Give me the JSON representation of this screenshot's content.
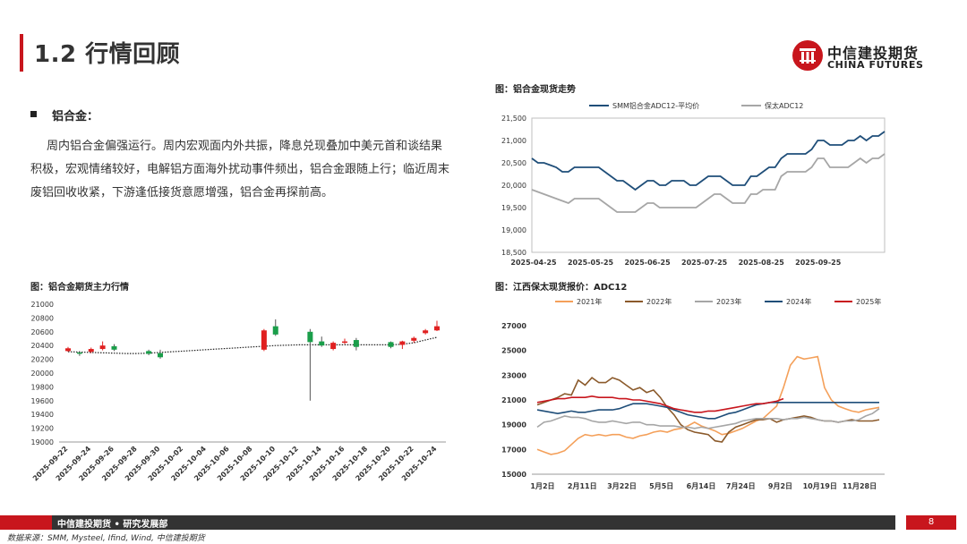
{
  "page": {
    "title": "1.2 行情回顾",
    "logo_cn": "中信建投期货",
    "logo_en": "CHINA FUTURES",
    "section_heading": "铝合金：",
    "paragraph_lines": [
      "周内铝合金偏强运行。周内宏观面内外共振，降息兑现叠加中美元首和谈结果",
      "积极，宏观情绪较好，电解铝方面海外扰动事件频出，铝合金跟随上行；临近周末",
      "废铝回收收紧，下游逢低接货意愿增强，铝合金再探前高。"
    ],
    "footer_label": "中信建投期货 • 研究发展部",
    "page_number": "8",
    "source": "数据来源：SMM, Mysteel, Ifind, Wind, 中信建投期货",
    "colors": {
      "accent": "#c8161d",
      "dark": "#333333"
    }
  },
  "chart_data": [
    {
      "id": "spot-trend",
      "type": "line",
      "title": "图：铝合金现货走势",
      "xlabels": [
        "2025-04-25",
        "2025-05-25",
        "2025-06-25",
        "2025-07-25",
        "2025-08-25",
        "2025-09-25"
      ],
      "yticks": [
        "21,500",
        "21,000",
        "20,500",
        "20,000",
        "19,500",
        "19,000",
        "18,500"
      ],
      "ylim": [
        18500,
        21500
      ],
      "series": [
        {
          "name": "SMM铝合金ADC12-平均价",
          "color": "#1f4e79",
          "values": [
            20600,
            20500,
            20500,
            20450,
            20400,
            20300,
            20300,
            20400,
            20400,
            20400,
            20400,
            20400,
            20300,
            20200,
            20100,
            20100,
            20000,
            19900,
            20000,
            20100,
            20100,
            20000,
            20000,
            20100,
            20100,
            20100,
            20000,
            20000,
            20100,
            20200,
            20200,
            20200,
            20100,
            20000,
            20000,
            20000,
            20200,
            20200,
            20300,
            20400,
            20400,
            20600,
            20700,
            20700,
            20700,
            20700,
            20800,
            21000,
            21000,
            20900,
            20900,
            20900,
            21000,
            21000,
            21100,
            21000,
            21100,
            21100,
            21200
          ]
        },
        {
          "name": "保太ADC12",
          "color": "#a6a6a6",
          "values": [
            19900,
            19850,
            19800,
            19750,
            19700,
            19650,
            19600,
            19700,
            19700,
            19700,
            19700,
            19700,
            19600,
            19500,
            19400,
            19400,
            19400,
            19400,
            19500,
            19600,
            19600,
            19500,
            19500,
            19500,
            19500,
            19500,
            19500,
            19500,
            19600,
            19700,
            19800,
            19800,
            19700,
            19600,
            19600,
            19600,
            19800,
            19800,
            19900,
            19900,
            19900,
            20200,
            20300,
            20300,
            20300,
            20300,
            20400,
            20600,
            20600,
            20400,
            20400,
            20400,
            20400,
            20500,
            20600,
            20500,
            20600,
            20600,
            20700
          ]
        }
      ]
    },
    {
      "id": "futures-candles",
      "type": "candlestick",
      "title": "图：铝合金期货主力行情",
      "xlabels": [
        "2025-09-22",
        "2025-09-24",
        "2025-09-26",
        "2025-09-28",
        "2025-09-30",
        "2025-10-02",
        "2025-10-04",
        "2025-10-06",
        "2025-10-08",
        "2025-10-10",
        "2025-10-12",
        "2025-10-14",
        "2025-10-16",
        "2025-10-18",
        "2025-10-20",
        "2025-10-22",
        "2025-10-24"
      ],
      "yticks": [
        "21000",
        "20800",
        "20600",
        "20400",
        "20200",
        "20000",
        "19800",
        "19600",
        "19400",
        "19200",
        "19000"
      ],
      "ylim": [
        19000,
        21000
      ],
      "candles": [
        {
          "date": "2025-09-22",
          "open": 20320,
          "close": 20360,
          "high": 20380,
          "low": 20310
        },
        {
          "date": "2025-09-23",
          "open": 20300,
          "close": 20290,
          "high": 20320,
          "low": 20250
        },
        {
          "date": "2025-09-24",
          "open": 20310,
          "close": 20350,
          "high": 20370,
          "low": 20290
        },
        {
          "date": "2025-09-25",
          "open": 20350,
          "close": 20400,
          "high": 20460,
          "low": 20330
        },
        {
          "date": "2025-09-26",
          "open": 20390,
          "close": 20340,
          "high": 20420,
          "low": 20320
        },
        {
          "date": "2025-09-29",
          "open": 20320,
          "close": 20280,
          "high": 20340,
          "low": 20260
        },
        {
          "date": "2025-09-30",
          "open": 20290,
          "close": 20230,
          "high": 20340,
          "low": 20210
        },
        {
          "date": "2025-10-09",
          "open": 20340,
          "close": 20620,
          "high": 20640,
          "low": 20320
        },
        {
          "date": "2025-10-10",
          "open": 20680,
          "close": 20560,
          "high": 20780,
          "low": 20540
        },
        {
          "date": "2025-10-13",
          "open": 20600,
          "close": 20450,
          "high": 20640,
          "low": 19600
        },
        {
          "date": "2025-10-14",
          "open": 20460,
          "close": 20400,
          "high": 20530,
          "low": 20380
        },
        {
          "date": "2025-10-15",
          "open": 20350,
          "close": 20440,
          "high": 20460,
          "low": 20330
        },
        {
          "date": "2025-10-16",
          "open": 20440,
          "close": 20460,
          "high": 20500,
          "low": 20420
        },
        {
          "date": "2025-10-17",
          "open": 20480,
          "close": 20380,
          "high": 20510,
          "low": 20330
        },
        {
          "date": "2025-10-20",
          "open": 20450,
          "close": 20380,
          "high": 20460,
          "low": 20360
        },
        {
          "date": "2025-10-21",
          "open": 20410,
          "close": 20460,
          "high": 20470,
          "low": 20350
        },
        {
          "date": "2025-10-22",
          "open": 20470,
          "close": 20510,
          "high": 20530,
          "low": 20440
        },
        {
          "date": "2025-10-23",
          "open": 20580,
          "close": 20620,
          "high": 20640,
          "low": 20560
        },
        {
          "date": "2025-10-24",
          "open": 20620,
          "close": 20680,
          "high": 20760,
          "low": 20610
        }
      ],
      "trend": [
        20310,
        20305,
        20300,
        20295,
        20290,
        20285,
        20285,
        20290,
        20300,
        20310,
        20320,
        20330,
        20340,
        20350,
        20360,
        20370,
        20380,
        20390,
        20400,
        20405,
        20410,
        20410,
        20410,
        20410,
        20410,
        20410,
        20410,
        20410,
        20410,
        20420,
        20440,
        20480,
        20520
      ],
      "colors": {
        "up": "#e02020",
        "down": "#1a9e4a",
        "trend": "#222222"
      }
    },
    {
      "id": "jiangxi-baotai",
      "type": "line",
      "title": "图：江西保太现货报价：ADC12",
      "xlabels": [
        "1月2日",
        "2月11日",
        "3月22日",
        "5月5日",
        "6月14日",
        "7月24日",
        "9月2日",
        "10月19日",
        "11月28日"
      ],
      "yticks": [
        "27000",
        "25000",
        "23000",
        "21000",
        "19000",
        "17000",
        "15000"
      ],
      "ylim": [
        15000,
        27000
      ],
      "series": [
        {
          "name": "2021年",
          "color": "#f4a05a",
          "values": [
            17000,
            16800,
            16600,
            16700,
            16900,
            17400,
            17900,
            18200,
            18100,
            18200,
            18100,
            18200,
            18200,
            18000,
            17900,
            18100,
            18200,
            18400,
            18500,
            18400,
            18600,
            18700,
            18900,
            19200,
            18900,
            18700,
            18500,
            18200,
            18300,
            18500,
            18700,
            19000,
            19300,
            19500,
            20000,
            20500,
            22000,
            23800,
            24500,
            24300,
            24400,
            24500,
            22000,
            21000,
            20500,
            20300,
            20100,
            20000,
            20200,
            20300,
            20400
          ]
        },
        {
          "name": "2022年",
          "color": "#8b5a2b",
          "values": [
            20600,
            20800,
            21000,
            21200,
            21500,
            21400,
            22600,
            22200,
            22800,
            22400,
            22400,
            22800,
            22600,
            22200,
            21800,
            22000,
            21600,
            21800,
            21200,
            20400,
            19800,
            19000,
            18600,
            18400,
            18300,
            18200,
            17700,
            17600,
            18400,
            18800,
            19000,
            19200,
            19400,
            19400,
            19500,
            19200,
            19400,
            19500,
            19600,
            19700,
            19600,
            19400,
            19300,
            19300,
            19200,
            19300,
            19400,
            19300,
            19300,
            19300,
            19400
          ]
        },
        {
          "name": "2023年",
          "color": "#a6a6a6",
          "values": [
            18800,
            19200,
            19300,
            19500,
            19700,
            19600,
            19600,
            19500,
            19300,
            19200,
            19200,
            19300,
            19200,
            19100,
            19200,
            19200,
            19000,
            19000,
            18900,
            18900,
            18900,
            18800,
            18800,
            18700,
            18800,
            18700,
            18800,
            18900,
            19000,
            19100,
            19300,
            19400,
            19500,
            19500,
            19500,
            19500,
            19400,
            19500,
            19500,
            19600,
            19500,
            19400,
            19300,
            19300,
            19200,
            19300,
            19300,
            19400,
            19700,
            19900,
            20300
          ]
        },
        {
          "name": "2024年",
          "color": "#1f4e79",
          "values": [
            20200,
            20100,
            20000,
            19900,
            20000,
            20100,
            20000,
            20000,
            20100,
            20200,
            20200,
            20200,
            20300,
            20500,
            20700,
            20700,
            20700,
            20600,
            20500,
            20400,
            20200,
            20000,
            19800,
            19700,
            19600,
            19500,
            19500,
            19700,
            19900,
            20000,
            20200,
            20400,
            20600,
            20700,
            20800,
            20800,
            20800,
            20800,
            20800,
            20800,
            20800,
            20800,
            20800,
            20800,
            20800,
            20800,
            20800,
            20800,
            20800,
            20800,
            20800
          ]
        },
        {
          "name": "2025年",
          "color": "#c8161d",
          "values": [
            20800,
            20900,
            21000,
            21100,
            21100,
            21200,
            21200,
            21200,
            21300,
            21200,
            21200,
            21200,
            21100,
            21100,
            21000,
            21000,
            20900,
            20800,
            20700,
            20500,
            20300,
            20200,
            20100,
            20000,
            20000,
            20100,
            20100,
            20200,
            20300,
            20400,
            20500,
            20600,
            20700,
            20700,
            20800,
            20900,
            21100
          ]
        }
      ]
    }
  ]
}
